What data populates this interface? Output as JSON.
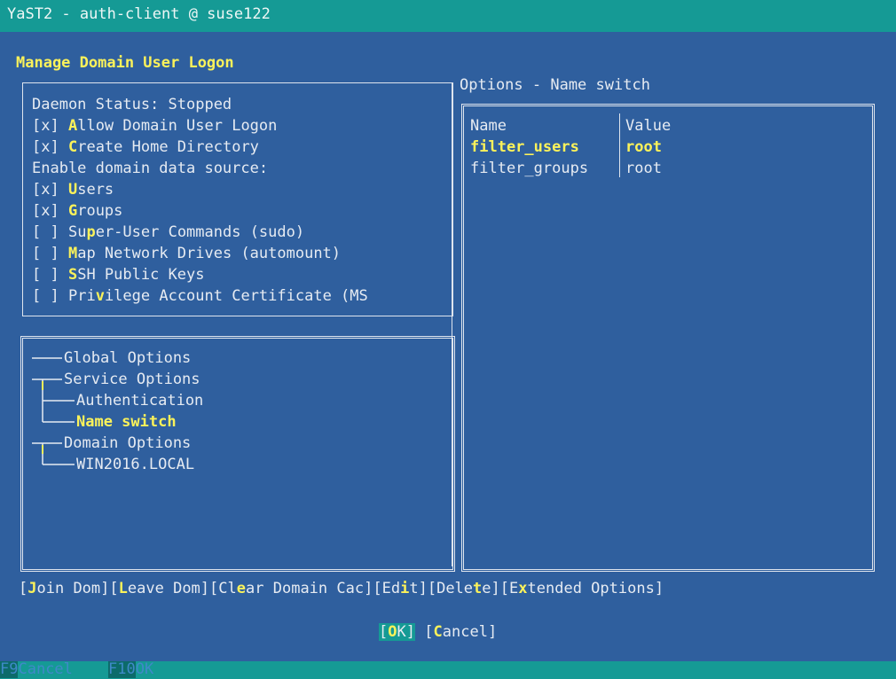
{
  "window": {
    "title": "YaST2 - auth-client @ suse122"
  },
  "heading": "Manage Domain User Logon",
  "daemon": {
    "status_text": "Daemon Status: Stopped",
    "allow_logon": {
      "mark": "[x]",
      "hot": "A",
      "rest": "llow Domain User Logon"
    },
    "create_home": {
      "mark": "[x]",
      "hot": "C",
      "rest": "reate Home Directory"
    },
    "source_label": "Enable domain data source:",
    "users": {
      "mark": "[x]",
      "hot": "U",
      "rest": "sers"
    },
    "groups": {
      "mark": "[x]",
      "hot": "G",
      "rest": "roups"
    },
    "sudo": {
      "mark": "[ ]",
      "pre": "Su",
      "hot": "p",
      "rest": "er-User Commands (sudo)"
    },
    "automount": {
      "mark": "[ ]",
      "hot": "M",
      "rest": "ap Network Drives (automount)"
    },
    "ssh": {
      "mark": "[ ]",
      "hot": "S",
      "rest": "SH Public Keys"
    },
    "pac": {
      "mark": "[ ]",
      "pre": "Pri",
      "hot": "v",
      "rest": "ilege Account Certificate (MS"
    }
  },
  "tree": {
    "global": "Global Options",
    "service": "Service Options",
    "authentication": "Authentication",
    "name_switch": "Name switch",
    "domain": "Domain Options",
    "win": "WIN2016.LOCAL"
  },
  "options": {
    "title": "Options - Name switch",
    "col_name": "Name",
    "col_value": "Value",
    "rows": [
      {
        "name": "filter_users",
        "value": "root"
      },
      {
        "name": "filter_groups",
        "value": "root"
      }
    ]
  },
  "buttons": {
    "join": {
      "pre": "",
      "hot": "J",
      "rest": "oin Dom"
    },
    "leave": {
      "pre": "",
      "hot": "L",
      "rest": "eave Dom"
    },
    "clear": {
      "pre": "Cl",
      "hot": "e",
      "rest": "ar Domain Cac"
    },
    "edit": {
      "pre": "Ed",
      "hot": "i",
      "rest": "t"
    },
    "delete": {
      "pre": "Dele",
      "hot": "t",
      "rest": "e"
    },
    "extended": {
      "pre": "E",
      "hot": "x",
      "rest": "tended Options"
    },
    "ok": {
      "hot": "O",
      "rest": "K"
    },
    "cancel": {
      "hot": "C",
      "rest": "ancel"
    }
  },
  "fkeys": {
    "f9": "F9",
    "f9_label": "Cancel",
    "f10": "F10",
    "f10_label": "OK"
  }
}
